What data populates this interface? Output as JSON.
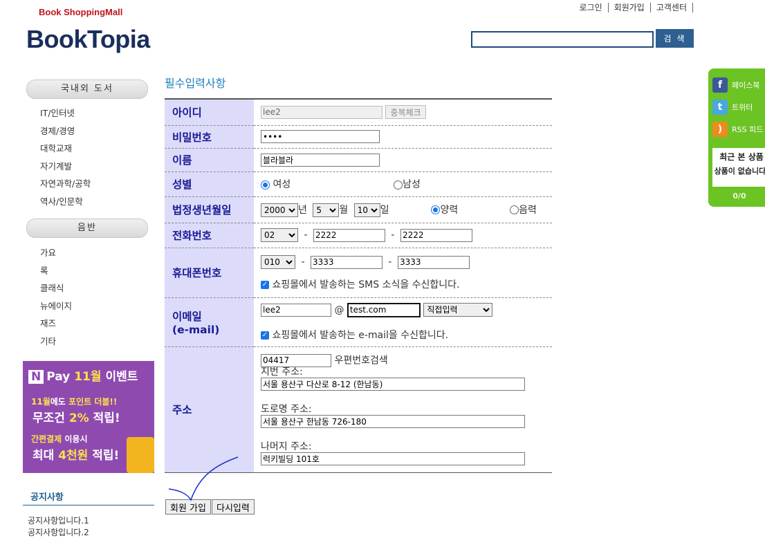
{
  "header": {
    "subtitle": "Book ShoppingMall",
    "logo": "BookTopia",
    "nav": [
      "로그인",
      "회원가입",
      "고객센터"
    ],
    "search_value": "",
    "search_button": "검 색"
  },
  "sidebar": {
    "category1": {
      "title": "국내외 도서",
      "items": [
        "IT/인터넷",
        "경제/경영",
        "대학교재",
        "자기계발",
        "자연과학/공학",
        "역사/인문학"
      ]
    },
    "category2": {
      "title": "음반",
      "items": [
        "가요",
        "록",
        "클래식",
        "뉴에이지",
        "재즈",
        "기타"
      ]
    },
    "banner": {
      "line1_pay": "Pay",
      "line1_month": "11월",
      "line1_event": "이벤트",
      "line2_a": "11월",
      "line2_b": "에도",
      "line2_c": "포인트 더블!!",
      "line3_a": "무조건",
      "line3_b": "2%",
      "line3_c": "적립!",
      "line4_a": "간편결제",
      "line4_b": "이용시",
      "line5_a": "최대",
      "line5_b": "4천원",
      "line5_c": "적립!"
    },
    "notice": {
      "title": "공지사항",
      "items": [
        "공지사항입니다.1",
        "공지사항입니다.2"
      ]
    }
  },
  "form": {
    "title": "필수입력사항",
    "labels": {
      "id": "아이디",
      "password": "비밀번호",
      "name": "이름",
      "gender": "성별",
      "birth": "법정생년월일",
      "phone": "전화번호",
      "mobile": "휴대폰번호",
      "email": "이메일",
      "email_en": "(e-mail)",
      "address": "주소"
    },
    "id_value": "lee2",
    "dup_check_button": "중복체크",
    "password_value": "••••",
    "name_value": "블라블라",
    "gender_female": "여성",
    "gender_male": "남성",
    "gender_selected": "여성",
    "birth_year": "2000",
    "birth_year_unit": "년",
    "birth_month": "5",
    "birth_month_unit": "월",
    "birth_day": "10",
    "birth_day_unit": "일",
    "calendar_solar": "양력",
    "calendar_lunar": "음력",
    "calendar_selected": "양력",
    "phone_prefix": "02",
    "phone_mid": "2222",
    "phone_last": "2222",
    "mobile_prefix": "010",
    "mobile_mid": "3333",
    "mobile_last": "3333",
    "sms_consent": "쇼핑몰에서 발송하는 SMS 소식을 수신합니다.",
    "sms_checked": true,
    "email_id": "lee2",
    "email_at": "@",
    "email_domain": "test.com",
    "email_domain_select": "직접입력",
    "email_consent": "쇼핑몰에서 발송하는 e-mail을 수신합니다.",
    "email_checked": true,
    "zipcode": "04417",
    "zipcode_search": "우편번호검색",
    "jibun_label": "지번 주소:",
    "jibun_value": "서울 용산구 다산로 8-12 (한남동)",
    "road_label": "도로명 주소:",
    "road_value": "서울 용산구 한남동 726-180",
    "rest_label": "나머지 주소:",
    "rest_value": "럭키빌딩 101호",
    "submit_button": "회원 가입",
    "reset_button": "다시입력"
  },
  "side_panel": {
    "facebook": "페이스북",
    "twitter": "트위터",
    "rss": "RSS 피드",
    "recent_title": "최근 본 상품",
    "recent_empty": "상품이 없습니다.",
    "recent_count": "0/0"
  },
  "colors": {
    "logo": "#1a2e5c",
    "subtitle": "#c0141c",
    "label_bg": "#dcdcfa",
    "label_text": "#1a1a96",
    "form_title": "#1d7fc0",
    "side_panel": "#6cc324",
    "banner": "#8f4ab0"
  }
}
